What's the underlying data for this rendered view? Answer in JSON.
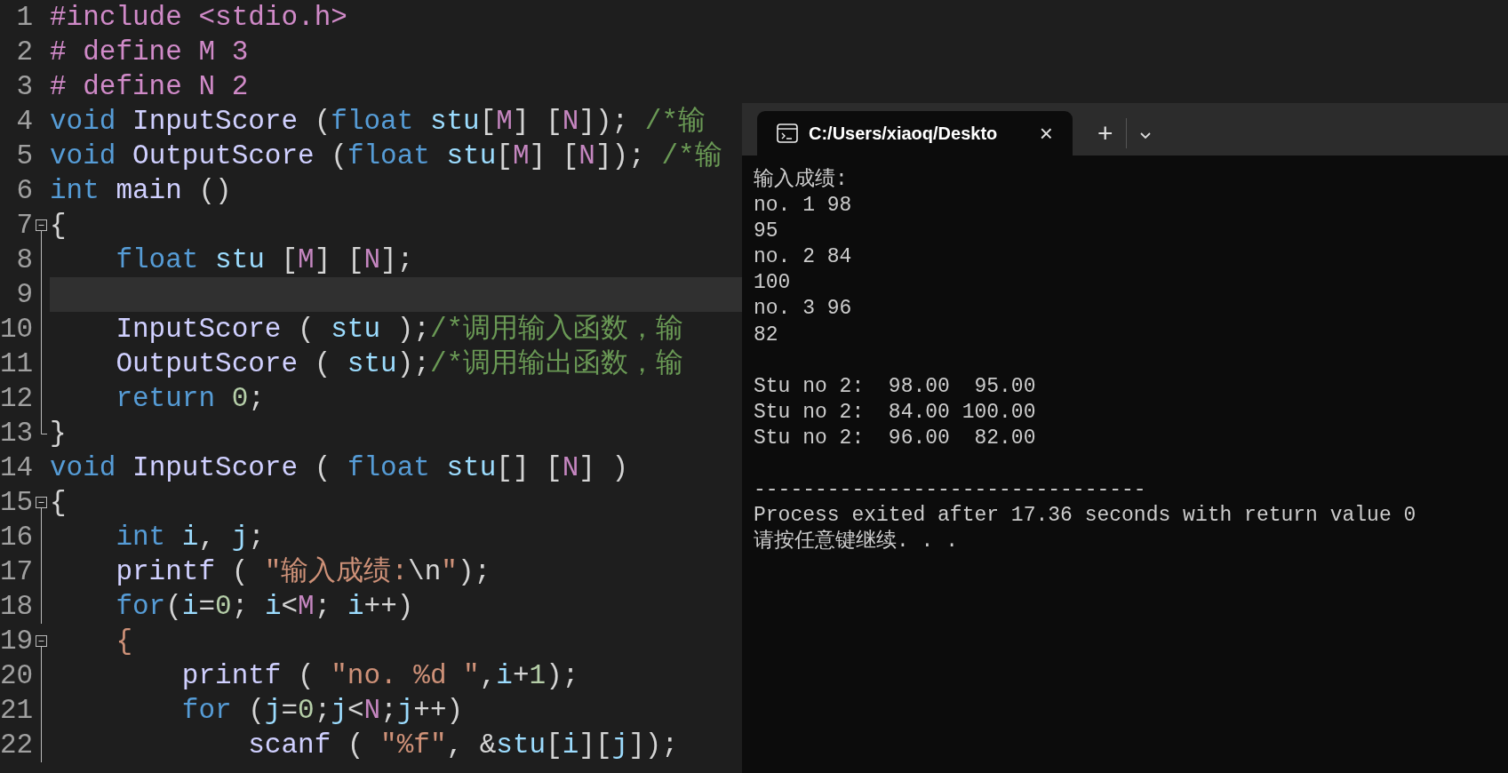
{
  "editor": {
    "lines": [
      {
        "number": "1",
        "kind": "plain",
        "tokens": [
          {
            "kind": "preproc",
            "text": "#include <stdio.h>"
          }
        ]
      },
      {
        "number": "2",
        "kind": "plain",
        "tokens": [
          {
            "kind": "preproc",
            "text": "# define M 3"
          }
        ]
      },
      {
        "number": "3",
        "kind": "plain",
        "tokens": [
          {
            "kind": "preproc",
            "text": "# define N 2"
          }
        ]
      },
      {
        "number": "4",
        "kind": "plain",
        "tokens": [
          {
            "kind": "keyword",
            "text": "void"
          },
          {
            "kind": "function",
            "text": " InputScore"
          },
          {
            "kind": "plain",
            "text": " ("
          },
          {
            "kind": "keyword",
            "text": "float"
          },
          {
            "kind": "variable",
            "text": " stu"
          },
          {
            "kind": "plain",
            "text": "["
          },
          {
            "kind": "macro",
            "text": "M"
          },
          {
            "kind": "plain",
            "text": "] ["
          },
          {
            "kind": "macro",
            "text": "N"
          },
          {
            "kind": "plain",
            "text": "]); "
          },
          {
            "kind": "comment",
            "text": "/*输"
          }
        ]
      },
      {
        "number": "5",
        "kind": "plain",
        "tokens": [
          {
            "kind": "keyword",
            "text": "void"
          },
          {
            "kind": "function",
            "text": " OutputScore"
          },
          {
            "kind": "plain",
            "text": " ("
          },
          {
            "kind": "keyword",
            "text": "float"
          },
          {
            "kind": "variable",
            "text": " stu"
          },
          {
            "kind": "plain",
            "text": "["
          },
          {
            "kind": "macro",
            "text": "M"
          },
          {
            "kind": "plain",
            "text": "] ["
          },
          {
            "kind": "macro",
            "text": "N"
          },
          {
            "kind": "plain",
            "text": "]); "
          },
          {
            "kind": "comment",
            "text": "/*输"
          }
        ]
      },
      {
        "number": "6",
        "kind": "plain",
        "tokens": [
          {
            "kind": "keyword",
            "text": "int"
          },
          {
            "kind": "function",
            "text": " main"
          },
          {
            "kind": "plain",
            "text": " ()"
          }
        ]
      },
      {
        "number": "7",
        "kind": "fold_start",
        "tokens": [
          {
            "kind": "plain",
            "text": "{"
          }
        ]
      },
      {
        "number": "8",
        "kind": "fold_body",
        "tokens": [
          {
            "kind": "keyword",
            "text": "    float"
          },
          {
            "kind": "variable",
            "text": " stu"
          },
          {
            "kind": "plain",
            "text": " ["
          },
          {
            "kind": "macro",
            "text": "M"
          },
          {
            "kind": "plain",
            "text": "] ["
          },
          {
            "kind": "macro",
            "text": "N"
          },
          {
            "kind": "plain",
            "text": "];"
          }
        ]
      },
      {
        "number": "9",
        "kind": "fold_body",
        "current": true
      },
      {
        "number": "10",
        "kind": "fold_body",
        "tokens": [
          {
            "kind": "function",
            "text": "    InputScore"
          },
          {
            "kind": "plain",
            "text": " ( "
          },
          {
            "kind": "variable",
            "text": "stu"
          },
          {
            "kind": "plain",
            "text": " );"
          },
          {
            "kind": "comment",
            "text": "/*调用输入函数，输"
          }
        ]
      },
      {
        "number": "11",
        "kind": "fold_body",
        "tokens": [
          {
            "kind": "function",
            "text": "    OutputScore"
          },
          {
            "kind": "plain",
            "text": " ( "
          },
          {
            "kind": "variable",
            "text": "stu"
          },
          {
            "kind": "plain",
            "text": ");"
          },
          {
            "kind": "comment",
            "text": "/*调用输出函数，输"
          }
        ]
      },
      {
        "number": "12",
        "kind": "fold_body",
        "tokens": [
          {
            "kind": "keyword",
            "text": "    return"
          },
          {
            "kind": "number",
            "text": " 0"
          },
          {
            "kind": "plain",
            "text": ";"
          }
        ]
      },
      {
        "number": "13",
        "kind": "fold_end",
        "tokens": [
          {
            "kind": "plain",
            "text": "}"
          }
        ]
      },
      {
        "number": "14",
        "kind": "plain",
        "tokens": [
          {
            "kind": "keyword",
            "text": "void"
          },
          {
            "kind": "function",
            "text": " InputScore"
          },
          {
            "kind": "plain",
            "text": " ( "
          },
          {
            "kind": "keyword",
            "text": "float"
          },
          {
            "kind": "variable",
            "text": " stu"
          },
          {
            "kind": "plain",
            "text": "[] ["
          },
          {
            "kind": "macro",
            "text": "N"
          },
          {
            "kind": "plain",
            "text": "] )"
          }
        ]
      },
      {
        "number": "15",
        "kind": "fold_start",
        "tokens": [
          {
            "kind": "plain",
            "text": "{"
          }
        ]
      },
      {
        "number": "16",
        "kind": "fold_body",
        "tokens": [
          {
            "kind": "keyword",
            "text": "    int"
          },
          {
            "kind": "variable",
            "text": " i"
          },
          {
            "kind": "plain",
            "text": ", "
          },
          {
            "kind": "variable",
            "text": "j"
          },
          {
            "kind": "plain",
            "text": ";"
          }
        ]
      },
      {
        "number": "17",
        "kind": "fold_body",
        "tokens": [
          {
            "kind": "function",
            "text": "    printf"
          },
          {
            "kind": "plain",
            "text": " ( "
          },
          {
            "kind": "string",
            "text": "\"输入成绩:"
          },
          {
            "kind": "plain",
            "text": "\\n"
          },
          {
            "kind": "string",
            "text": "\""
          },
          {
            "kind": "plain",
            "text": ");"
          }
        ]
      },
      {
        "number": "18",
        "kind": "fold_body",
        "tokens": [
          {
            "kind": "keyword",
            "text": "    for"
          },
          {
            "kind": "plain",
            "text": "("
          },
          {
            "kind": "variable",
            "text": "i"
          },
          {
            "kind": "plain",
            "text": "="
          },
          {
            "kind": "number",
            "text": "0"
          },
          {
            "kind": "plain",
            "text": "; "
          },
          {
            "kind": "variable",
            "text": "i"
          },
          {
            "kind": "plain",
            "text": "<"
          },
          {
            "kind": "macro",
            "text": "M"
          },
          {
            "kind": "plain",
            "text": "; "
          },
          {
            "kind": "variable",
            "text": "i"
          },
          {
            "kind": "plain",
            "text": "++)"
          }
        ]
      },
      {
        "number": "19",
        "kind": "fold_start",
        "tokens": [
          {
            "kind": "brace",
            "text": "    {"
          }
        ]
      },
      {
        "number": "20",
        "kind": "fold_body",
        "tokens": [
          {
            "kind": "function",
            "text": "        printf"
          },
          {
            "kind": "plain",
            "text": " ( "
          },
          {
            "kind": "string",
            "text": "\"no. %d \""
          },
          {
            "kind": "plain",
            "text": ","
          },
          {
            "kind": "variable",
            "text": "i"
          },
          {
            "kind": "plain",
            "text": "+"
          },
          {
            "kind": "number",
            "text": "1"
          },
          {
            "kind": "plain",
            "text": ");"
          }
        ]
      },
      {
        "number": "21",
        "kind": "fold_body",
        "tokens": [
          {
            "kind": "keyword",
            "text": "        for"
          },
          {
            "kind": "plain",
            "text": " ("
          },
          {
            "kind": "variable",
            "text": "j"
          },
          {
            "kind": "plain",
            "text": "="
          },
          {
            "kind": "number",
            "text": "0"
          },
          {
            "kind": "plain",
            "text": ";"
          },
          {
            "kind": "variable",
            "text": "j"
          },
          {
            "kind": "plain",
            "text": "<"
          },
          {
            "kind": "macro",
            "text": "N"
          },
          {
            "kind": "plain",
            "text": ";"
          },
          {
            "kind": "variable",
            "text": "j"
          },
          {
            "kind": "plain",
            "text": "++)"
          }
        ]
      },
      {
        "number": "22",
        "kind": "fold_body",
        "tokens": [
          {
            "kind": "function",
            "text": "            scanf"
          },
          {
            "kind": "plain",
            "text": " ( "
          },
          {
            "kind": "string",
            "text": "\"%f\""
          },
          {
            "kind": "plain",
            "text": ", &"
          },
          {
            "kind": "variable",
            "text": "stu"
          },
          {
            "kind": "plain",
            "text": "["
          },
          {
            "kind": "variable",
            "text": "i"
          },
          {
            "kind": "plain",
            "text": "]["
          },
          {
            "kind": "variable",
            "text": "j"
          },
          {
            "kind": "plain",
            "text": "]);"
          }
        ]
      }
    ]
  },
  "terminal": {
    "tab": {
      "title": "C:/Users/xiaoq/Deskto",
      "close": "×"
    },
    "new_tab": "+",
    "output_blocks": [
      [
        "输入成绩:",
        "no. 1 98",
        "95",
        "no. 2 84",
        "100",
        "no. 3 96",
        "82"
      ],
      [
        "Stu no 2:  98.00  95.00",
        "Stu no 2:  84.00 100.00",
        "Stu no 2:  96.00  82.00"
      ],
      [
        "--------------------------------",
        "Process exited after 17.36 seconds with return value 0",
        "请按任意键继续. . ."
      ]
    ]
  }
}
